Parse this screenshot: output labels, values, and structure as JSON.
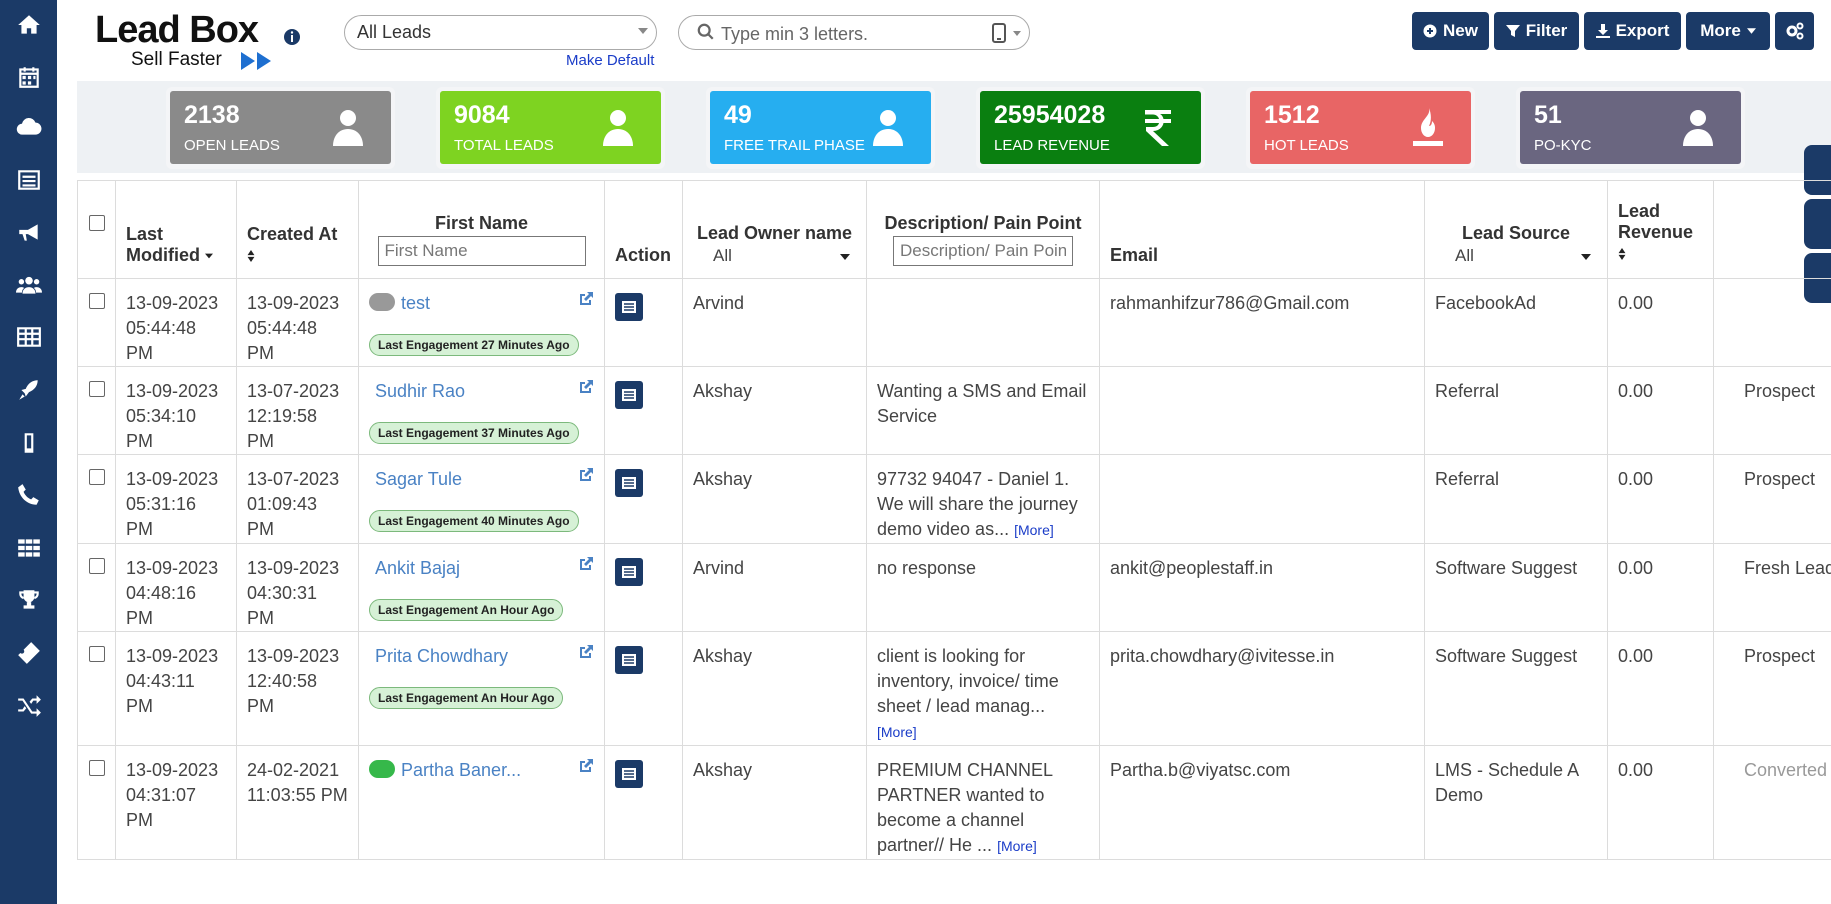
{
  "sidebar": {
    "icons": [
      "home-icon",
      "calendar-icon",
      "cloud-icon",
      "list-icon",
      "megaphone-icon",
      "users-icon",
      "table-icon",
      "rocket-icon",
      "mobile-icon",
      "phone-icon",
      "apps-grid-icon",
      "trophy-icon",
      "ticket-icon",
      "shuffle-icon"
    ]
  },
  "header": {
    "logo_main": "Lead Box",
    "logo_sub": "Sell Faster",
    "view_select": "All Leads",
    "make_default": "Make Default",
    "search_placeholder": "Type min 3 letters.",
    "buttons": {
      "new": "New",
      "filter": "Filter",
      "export": "Export",
      "more": "More"
    }
  },
  "stats": [
    {
      "value": "2138",
      "label": "OPEN LEADS",
      "color": "#8a8a8a",
      "icon": "user-icon"
    },
    {
      "value": "9084",
      "label": "TOTAL LEADS",
      "color": "#7ed321",
      "icon": "user-icon"
    },
    {
      "value": "49",
      "label": "FREE TRAIL PHASE",
      "color": "#26aef0",
      "icon": "user-icon"
    },
    {
      "value": "25954028",
      "label": "LEAD REVENUE",
      "color": "#0a7f10",
      "icon": "rupee-icon"
    },
    {
      "value": "1512",
      "label": "HOT LEADS",
      "color": "#e86565",
      "icon": "fire-icon"
    },
    {
      "value": "51",
      "label": "PO-KYC",
      "color": "#6a6680",
      "icon": "user-icon"
    }
  ],
  "table": {
    "headers": {
      "last_modified": "Last Modified",
      "created_at": "Created At",
      "first_name": "First Name",
      "first_name_placeholder": "First Name",
      "action": "Action",
      "lead_owner": "Lead Owner name",
      "lead_owner_filter": "All",
      "description": "Description/ Pain Point",
      "description_placeholder": "Description/ Pain Point",
      "email": "Email",
      "lead_source": "Lead Source",
      "lead_source_filter": "All",
      "lead_revenue": "Lead Revenue"
    },
    "rows": [
      {
        "modified_date": "13-09-2023",
        "modified_time": "05:44:48 PM",
        "created_date": "13-09-2023",
        "created_time": "05:44:48 PM",
        "name": "test",
        "prefix": "gray",
        "engagement": "Last Engagement 27 Minutes Ago",
        "owner": "Arvind",
        "description": "",
        "more": "",
        "email": "rahmanhifzur786@Gmail.com",
        "source": "FacebookAd",
        "revenue": "0.00",
        "status": ""
      },
      {
        "modified_date": "13-09-2023",
        "modified_time": "05:34:10 PM",
        "created_date": "13-07-2023",
        "created_time": "12:19:58 PM",
        "name": "Sudhir Rao",
        "prefix": "",
        "engagement": "Last Engagement 37 Minutes Ago",
        "owner": "Akshay",
        "description": "Wanting a SMS and Email Service",
        "more": "",
        "email": "",
        "source": "Referral",
        "revenue": "0.00",
        "status": "Prospect"
      },
      {
        "modified_date": "13-09-2023",
        "modified_time": "05:31:16 PM",
        "created_date": "13-07-2023",
        "created_time": "01:09:43 PM",
        "name": "Sagar Tule",
        "prefix": "",
        "engagement": "Last Engagement 40 Minutes Ago",
        "owner": "Akshay",
        "description": "97732 94047 - Daniel 1. We will share the journey demo video as...",
        "more": "[More]",
        "email": "",
        "source": "Referral",
        "revenue": "0.00",
        "status": "Prospect"
      },
      {
        "modified_date": "13-09-2023",
        "modified_time": "04:48:16 PM",
        "created_date": "13-09-2023",
        "created_time": "04:30:31 PM",
        "name": "Ankit Bajaj",
        "prefix": "",
        "engagement": "Last Engagement An Hour Ago",
        "owner": "Arvind",
        "description": "no response",
        "more": "",
        "email": "ankit@peoplestaff.in",
        "source": "Software Suggest",
        "revenue": "0.00",
        "status": "Fresh Lead"
      },
      {
        "modified_date": "13-09-2023",
        "modified_time": "04:43:11 PM",
        "created_date": "13-09-2023",
        "created_time": "12:40:58 PM",
        "name": "Prita Chowdhary",
        "prefix": "",
        "engagement": "Last Engagement An Hour Ago",
        "owner": "Akshay",
        "description": "client is looking for inventory, invoice/ time sheet / lead manag...",
        "more": "[More]",
        "email": "prita.chowdhary@ivitesse.in",
        "source": "Software Suggest",
        "revenue": "0.00",
        "status": "Prospect"
      },
      {
        "modified_date": "13-09-2023",
        "modified_time": "04:31:07 PM",
        "created_date": "24-02-2021",
        "created_time": "11:03:55 PM",
        "name": "Partha Baner...",
        "prefix": "green",
        "engagement": "",
        "owner": "Akshay",
        "description": "PREMIUM CHANNEL PARTNER wanted to become a channel partner// He ...",
        "more": "[More]",
        "email": "Partha.b@viyatsc.com",
        "source": "LMS - Schedule A Demo",
        "revenue": "0.00",
        "status": "Converted"
      }
    ]
  }
}
